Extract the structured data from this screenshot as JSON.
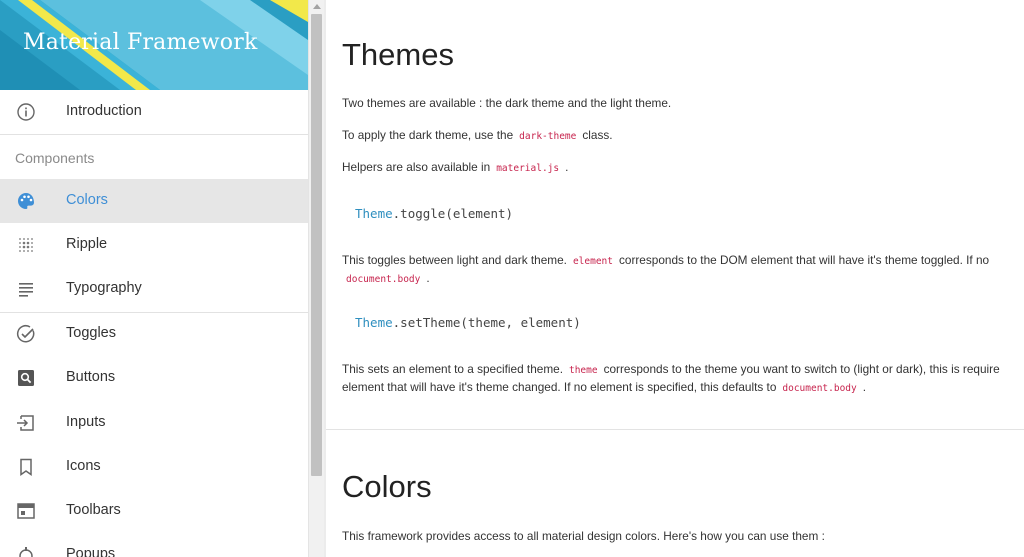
{
  "sidebar": {
    "brand": "Material Framework",
    "intro": {
      "label": "Introduction",
      "icon": "info-circle-icon"
    },
    "section": "Components",
    "items": [
      {
        "label": "Colors",
        "icon": "palette-icon",
        "active": true
      },
      {
        "label": "Ripple",
        "icon": "dot-grid-icon"
      },
      {
        "label": "Typography",
        "icon": "text-lines-icon"
      },
      {
        "label": "Toggles",
        "icon": "check-circle-icon"
      },
      {
        "label": "Buttons",
        "icon": "search-box-icon"
      },
      {
        "label": "Inputs",
        "icon": "input-arrow-icon"
      },
      {
        "label": "Icons",
        "icon": "bookmark-icon"
      },
      {
        "label": "Toolbars",
        "icon": "toolbar-window-icon"
      },
      {
        "label": "Popups",
        "icon": "popup-icon"
      }
    ]
  },
  "main": {
    "themes": {
      "title": "Themes",
      "p1": "Two themes are available : the dark theme and the light theme.",
      "p2_pre": "To apply the dark theme, use the",
      "p2_code": "dark-theme",
      "p2_post": "class.",
      "p3_pre": "Helpers are also available in",
      "p3_code": "material.js",
      "p3_post": ".",
      "code1_obj": "Theme",
      "code1_rest": ".toggle(element)",
      "p4_pre": "This toggles between light and dark theme.",
      "p4_code": "element",
      "p4_post": "corresponds to the DOM element that will have it's theme toggled. If no",
      "p4_line2_code": "document.body",
      "p4_line2_post": ".",
      "code2_obj": "Theme",
      "code2_rest": ".setTheme(theme, element)",
      "p5_pre": "This sets an element to a specified theme.",
      "p5_code": "theme",
      "p5_post": "corresponds to the theme you want to switch to (light or dark), this is require",
      "p5_line2_pre": "element that will have it's theme changed. If no element is specified, this defaults to",
      "p5_line2_code": "document.body",
      "p5_line2_post": "."
    },
    "colors": {
      "title": "Colors",
      "p1": "This framework provides access to all material design colors. Here's how you can use them :"
    }
  },
  "colors": {
    "accent": "#3f8fd6",
    "header_blue": "#2a9ec3",
    "header_yellow": "#f2e84a",
    "code_red": "#c7254e"
  }
}
